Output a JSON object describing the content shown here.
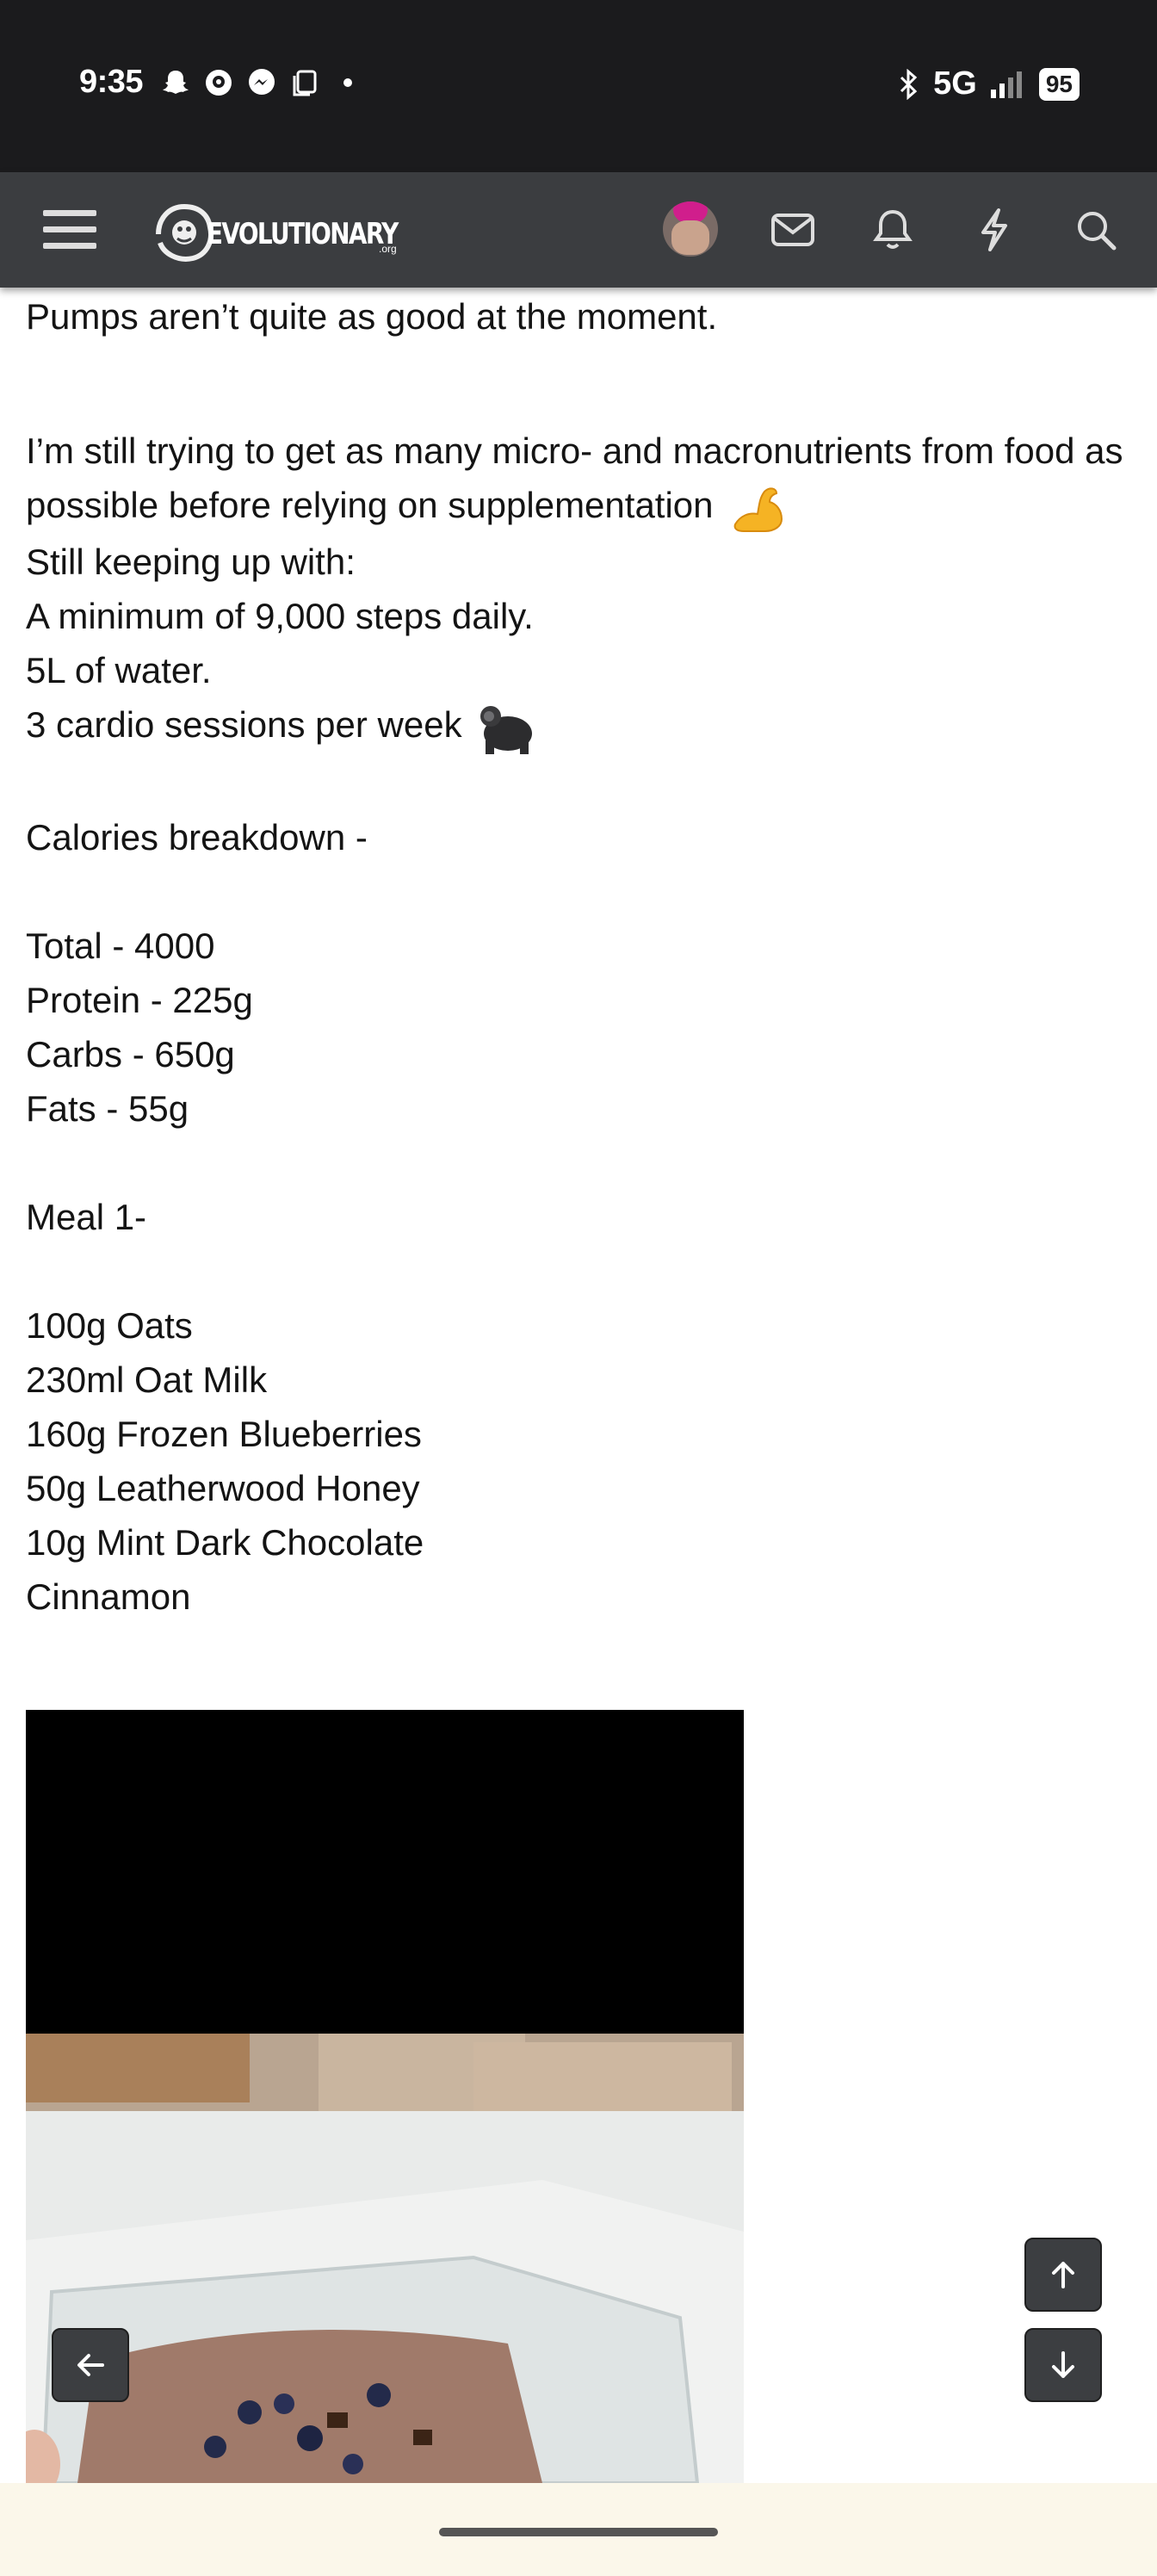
{
  "status_bar": {
    "time": "9:35",
    "network": "5G",
    "battery": "95",
    "icons": [
      "snapchat-icon",
      "messenger-bubble-icon",
      "messenger-icon",
      "copy-icon",
      "dot-icon",
      "bluetooth-icon",
      "signal-icon"
    ]
  },
  "header": {
    "logo_text": "EVOLUTIONARY",
    "logo_suffix": ".org",
    "icons": [
      "menu-icon",
      "avatar",
      "inbox-icon",
      "alerts-icon",
      "whats-new-icon",
      "search-icon"
    ]
  },
  "post": {
    "lines": [
      "Pumps aren’t quite as good at the moment.",
      "",
      "I’m still trying to get as many micro- and macronutrients from food as possible before relying on supplementation",
      "Still keeping up with:",
      "A minimum of 9,000 steps daily.",
      "5L of water.",
      "3 cardio sessions per week",
      "",
      "Calories breakdown -",
      "",
      "Total - 4000",
      "Protein - 225g",
      "Carbs - 650g",
      "Fats - 55g",
      "",
      "Meal 1-",
      "",
      "100g Oats",
      "230ml Oat Milk",
      "160g Frozen Blueberries",
      "50g Leatherwood Honey",
      "10g Mint Dark Chocolate",
      "Cinnamon"
    ],
    "emojis": {
      "flex": "flexed-biceps-emoji",
      "gorilla": "gorilla-emoji"
    },
    "image": {
      "description_icon": "meal-photo"
    }
  },
  "floating": {
    "back": "arrow-left-icon",
    "up": "arrow-up-icon",
    "down": "arrow-down-icon"
  }
}
